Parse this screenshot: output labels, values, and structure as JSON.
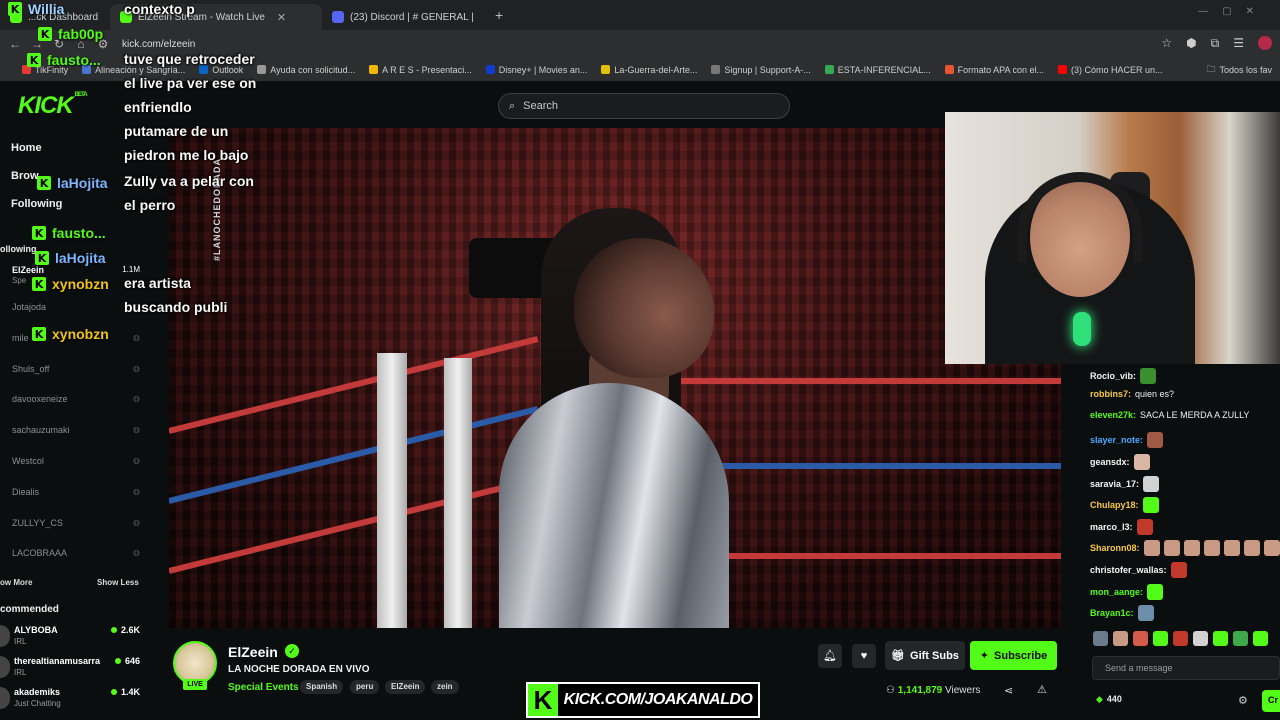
{
  "browser": {
    "tabs": [
      {
        "title": "...ck Dashboard",
        "color": "#53fc18"
      },
      {
        "title": "ElZeein Stream - Watch Live",
        "color": "#53fc18"
      },
      {
        "title": "(23) Discord | # GENERAL |",
        "color": "#5865f2"
      }
    ],
    "url": "kick.com/elzeein",
    "bookmarks": [
      {
        "label": "TikFinity",
        "color": "#e53935"
      },
      {
        "label": "Alineación y Sangría...",
        "color": "#4a76d0"
      },
      {
        "label": "Outlook",
        "color": "#0a64c7"
      },
      {
        "label": "Ayuda con solicitud...",
        "color": "#999999"
      },
      {
        "label": "A R E S - Presentaci...",
        "color": "#f2b705"
      },
      {
        "label": "Disney+ | Movies an...",
        "color": "#113ccf"
      },
      {
        "label": "La-Guerra-del-Arte...",
        "color": "#e0c200"
      },
      {
        "label": "Signup | Support-A-...",
        "color": "#777777"
      },
      {
        "label": "ESTA-INFERENCIAL...",
        "color": "#34a853"
      },
      {
        "label": "Formato APA con el...",
        "color": "#e8542e"
      },
      {
        "label": "(3) Cómo HACER un...",
        "color": "#ff0000"
      }
    ],
    "bookmarks_folder": "Todos los fav"
  },
  "kick": {
    "logo": "KICK",
    "logo_badge": "BETA",
    "search_placeholder": "Search",
    "accent": "#53fc18"
  },
  "sidebar": {
    "nav": [
      "Home",
      "Brow",
      "Following"
    ],
    "following_label": "ollowing",
    "active_channel": {
      "name": "ElZeein",
      "sub": "Spe",
      "viewers": "1.1M"
    },
    "channels": [
      "Jotajoda",
      "mile",
      "Shuls_off",
      "davooxeneize",
      "sachauzumaki",
      "Westcol",
      "Diealis",
      "ZULLYY_CS",
      "LACOBRAAA"
    ],
    "show_more": "ow More",
    "show_less": "Show Less",
    "recommended_label": "commended",
    "recommended": [
      {
        "name": "ALYBOBA",
        "category": "IRL",
        "viewers": "2.6K"
      },
      {
        "name": "therealtianamusarra",
        "category": "IRL",
        "viewers": "646"
      },
      {
        "name": "akademiks",
        "category": "Just Chatting",
        "viewers": "1.4K"
      }
    ]
  },
  "overlay_chat": {
    "rows": [
      {
        "user": "Willia",
        "color": "#9fd0ff"
      },
      {
        "user": "fab00p",
        "color": "#53fc18"
      },
      {
        "user": "fausto...",
        "color": "#53fc18"
      },
      {
        "user": "laHojita",
        "color": "#7bb6ff"
      },
      {
        "user": "fausto...",
        "color": "#53fc18"
      },
      {
        "user": "laHojita",
        "color": "#7bb6ff"
      },
      {
        "user": "xynobzn",
        "color": "#f0c419"
      },
      {
        "user": "xynobzn",
        "color": "#f0c419"
      }
    ],
    "messages": [
      "contexto p",
      "tuve que retroceder",
      "el live pa ver ese on",
      "enfriendlo",
      "putamare de un",
      "piedron me lo bajo",
      "Zully va a pelar con",
      "el perro",
      "era artista",
      "buscando publi"
    ]
  },
  "video": {
    "side_text": "#LANOCHEDORADA"
  },
  "chat": {
    "messages": [
      {
        "user": "Rocio_vib:",
        "text": "",
        "color": "#f5f5f5",
        "emote": "#3a8f2e"
      },
      {
        "user": "robbins7:",
        "text": "quien es?",
        "color": "#f7c948",
        "emote": ""
      },
      {
        "user": "eleven27k:",
        "text": "SACA LE MERDA A ZULLY",
        "color": "#53fc18",
        "emote": ""
      },
      {
        "user": "slayer_note:",
        "text": "",
        "color": "#4aa8ff",
        "emote": "#a05a44"
      },
      {
        "user": "geansdx:",
        "text": "",
        "color": "#f5f5f5",
        "emote": "#d9b7a5"
      },
      {
        "user": "saravia_17:",
        "text": "",
        "color": "#f5f5f5",
        "emote": "#d2d2d2"
      },
      {
        "user": "Chulapy18:",
        "text": "",
        "color": "#f7c948",
        "emote": "#53fc18"
      },
      {
        "user": "marco_l3:",
        "text": "",
        "color": "#f5f5f5",
        "emote": "#c0392b"
      },
      {
        "user": "Sharonn08:",
        "text": "",
        "color": "#f7c948",
        "emote": "#c89a86"
      },
      {
        "user": "christofer_wallas:",
        "text": "",
        "color": "#f5f5f5",
        "emote": "#c0392b"
      },
      {
        "user": "mon_aange:",
        "text": "",
        "color": "#53fc18",
        "emote": "#53fc18"
      },
      {
        "user": "Brayan1c:",
        "text": "",
        "color": "#53fc18",
        "emote": "#6c8ea8"
      }
    ],
    "input_placeholder": "Send a message",
    "points": "440",
    "send_label": "Cr"
  },
  "stream": {
    "name": "ElZeein",
    "title": "LA NOCHE DORADA EN VIVO",
    "category": "Special Events",
    "tags": [
      "Spanish",
      "peru",
      "ElZeein",
      "zein"
    ],
    "live": "LIVE",
    "gift_label": "Gift Subs",
    "subscribe_label": "Subscribe",
    "viewers": "1,141,879",
    "viewers_label": "Viewers"
  },
  "watermark": "KICK.COM/JOAKANALDO"
}
